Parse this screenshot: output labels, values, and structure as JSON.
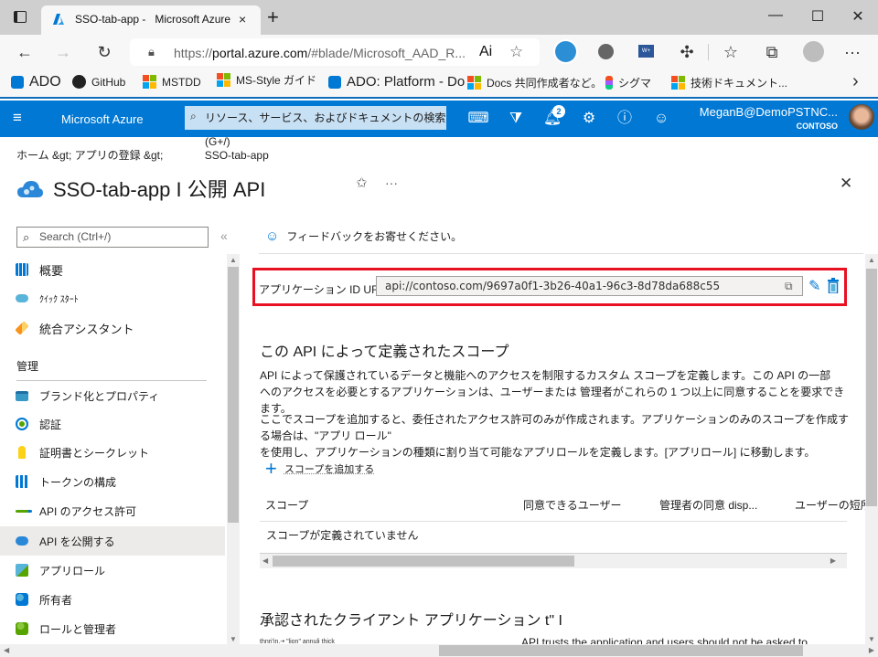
{
  "browser": {
    "tab_title": "SSO-tab-app -   Microsoft Azure",
    "tab_close": "×",
    "new_tab": "+",
    "url_prefix": "https://",
    "url_host": "portal.azure.com",
    "url_path": "/#blade/Microsoft_AAD_R...",
    "read_aloud": "Ai",
    "minimize": "—",
    "maximize": "☐",
    "close": "✕",
    "bookmarks": [
      {
        "label": "ADO",
        "icon": "azure-devops-icon"
      },
      {
        "label": "GitHub",
        "icon": "github-icon"
      },
      {
        "label": "MSTDD",
        "icon": "microsoft-icon"
      },
      {
        "label": "MS-Style ガイド",
        "icon": "microsoft-icon"
      },
      {
        "label": "ADO: Platform - Do",
        "icon": "azure-devops-icon"
      },
      {
        "label": "Docs 共同作成者など。",
        "icon": "microsoft-icon"
      },
      {
        "label": "シグマ",
        "icon": "figma-icon"
      },
      {
        "label": "技術ドキュメント...",
        "icon": "microsoft-icon"
      }
    ],
    "more_bookmarks": "›"
  },
  "azure": {
    "brand": "Microsoft Azure",
    "search_placeholder": "リソース、サービス、およびドキュメントの検索 (G+/)",
    "notifications_count": "2",
    "user_name": "MeganB@DemoPSTNC...",
    "tenant": "CONTOSO"
  },
  "page": {
    "breadcrumb_home": "ホーム &gt;",
    "breadcrumb_apps": "アプリの登録 &gt;",
    "breadcrumb_current": "SSO-tab-app",
    "title": "SSO-tab-app I 公開 API",
    "pin": "✩",
    "more": "···",
    "close": "✕"
  },
  "sidebar": {
    "search_placeholder": "Search (Ctrl+/)",
    "collapse": "«",
    "items_top": [
      {
        "label": "概要",
        "icon": "overview-icon",
        "color": "#0078d4"
      },
      {
        "label": "ｸｲｯｸ ｽﾀｰﾄ",
        "icon": "quickstart-icon",
        "color": "#59b4d9"
      },
      {
        "label": "統合アシスタント",
        "icon": "rocket-icon",
        "color": "#f7941d"
      }
    ],
    "section_label": "管理",
    "items_manage": [
      {
        "label": "ブランド化とプロパティ",
        "icon": "branding-icon",
        "color": "#3999c6"
      },
      {
        "label": "認証",
        "icon": "authentication-icon",
        "color": "#0078d4"
      },
      {
        "label": "証明書とシークレット",
        "icon": "key-icon",
        "color": "#fcd116"
      },
      {
        "label": "トークンの構成",
        "icon": "token-icon",
        "color": "#0078d4"
      },
      {
        "label": "API のアクセス許可",
        "icon": "api-permissions-icon",
        "color": "#0078d4"
      },
      {
        "label": "API を公開する",
        "icon": "expose-api-icon",
        "color": "#0078d4",
        "active": true
      },
      {
        "label": "アプリロール",
        "icon": "app-roles-icon",
        "color": "#0078d4"
      },
      {
        "label": "所有者",
        "icon": "owners-icon",
        "color": "#0078d4"
      },
      {
        "label": "ロールと管理者",
        "icon": "roles-admins-icon",
        "color": "#57a300"
      }
    ]
  },
  "main": {
    "feedback": "フィードバックをお寄せください。",
    "uri_label": "アプリケーション ID URI",
    "uri_value": "api://contoso.com/9697a0f1-3b26-40a1-96c3-8d78da688c55",
    "scopes_heading": "この API によって定義されたスコープ",
    "para1_line1": "API によって保護されているデータと機能へのアクセスを制限するカスタム スコープを定義します。この API の一部",
    "para1_line2": "へのアクセスを必要とするアプリケーションは、ユーザーまたは 管理者がこれらの 1 つ以上に同意することを要求できます。",
    "para2_line1": "ここでスコープを追加すると、委任されたアクセス許可のみが作成されます。アプリケーションのみのスコープを作成する場合は、\"アプリ ロール\"",
    "para2_line2": "を使用し、アプリケーションの種類に割り当て可能なアプリロールを定義します。[アプリロール] に移動します。",
    "add_scope": "スコープを追加する",
    "table_headers": [
      "スコープ",
      "同意できるユーザー",
      "管理者の同意 disp...",
      "ユーザーの短所"
    ],
    "empty_message": "スコープが定義されていません",
    "approved_heading": "承認されたクライアント アプリケーション t\" I",
    "garbled_text": "thnri'in.-• \"lion\" annuli thick",
    "trusts_text": "API trusts the application and users should not be asked to"
  },
  "colors": {
    "azure_blue": "#0078d4",
    "highlight_red": "#e81123",
    "active_item": "#edebe9"
  }
}
